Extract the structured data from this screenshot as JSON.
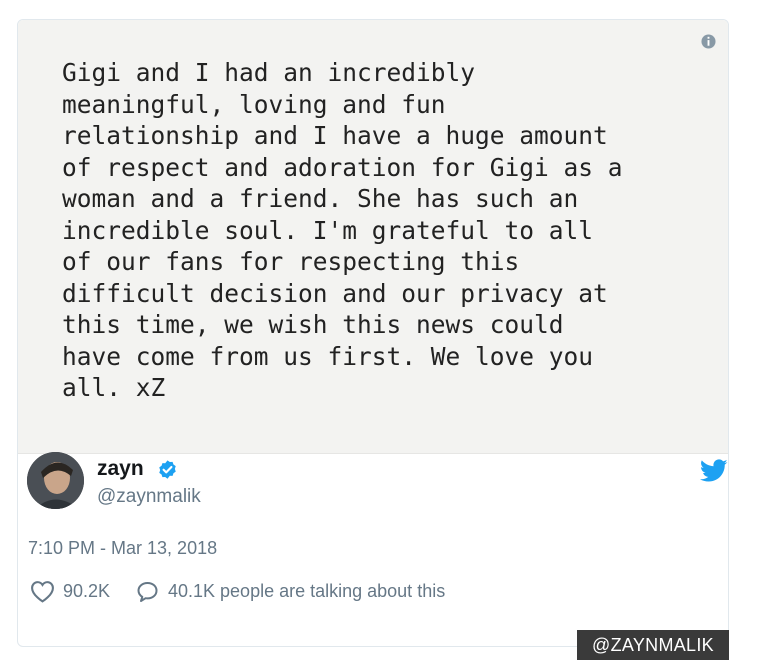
{
  "note": {
    "text": "Gigi and I had an incredibly\nmeaningful, loving and fun\nrelationship and I have a huge amount\nof respect and adoration for Gigi as a\nwoman and a friend. She has such an\nincredible soul. I'm grateful to all\nof our fans for respecting this\ndifficult decision and our privacy at\nthis time, we wish this news could\nhave come from us first. We love you\nall. xZ"
  },
  "author": {
    "name": "zayn",
    "handle": "@zaynmalik"
  },
  "tweet": {
    "timestamp": "7:10 PM - Mar 13, 2018",
    "likes": "90.2K",
    "replies_text": "40.1K people are talking about this"
  },
  "watermark": "@ZAYNMALIK",
  "colors": {
    "twitter_blue": "#1da1f2",
    "secondary_text": "#657786",
    "note_background": "#f3f3f1"
  },
  "icons": [
    "info-icon",
    "verified-badge-icon",
    "twitter-bird-icon",
    "heart-icon",
    "reply-icon"
  ]
}
